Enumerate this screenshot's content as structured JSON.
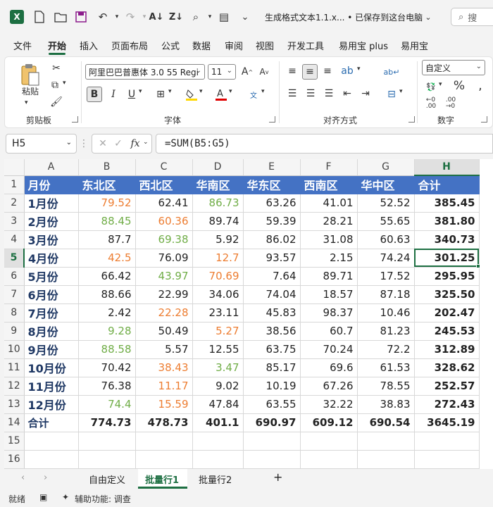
{
  "titlebar": {
    "document_title": "生成格式文本1.1.x... • 已保存到这台电脑",
    "search_placeholder": "搜"
  },
  "menu": [
    "文件",
    "开始",
    "插入",
    "页面布局",
    "公式",
    "数据",
    "审阅",
    "视图",
    "开发工具",
    "易用宝 plus",
    "易用宝"
  ],
  "ribbon": {
    "paste_label": "粘贴",
    "font_name": "阿里巴巴普惠体 3.0 55 Regi",
    "font_size": "11",
    "bold": "B",
    "italic": "I",
    "number_format": "自定义",
    "groups": {
      "clipboard": "剪贴板",
      "font": "字体",
      "alignment": "对齐方式",
      "number": "数字"
    }
  },
  "formula_bar": {
    "name_box": "H5",
    "formula": "=SUM(B5:G5)"
  },
  "grid": {
    "columns": [
      "A",
      "B",
      "C",
      "D",
      "E",
      "F",
      "G",
      "H"
    ],
    "row_numbers": [
      "1",
      "2",
      "3",
      "4",
      "5",
      "6",
      "7",
      "8",
      "9",
      "10",
      "11",
      "12",
      "13",
      "14",
      "15",
      "16"
    ],
    "header": [
      "月份",
      "东北区",
      "西北区",
      "华南区",
      "华东区",
      "西南区",
      "华中区",
      "合计"
    ],
    "rows": [
      {
        "label": "1月份",
        "values": [
          "79.52",
          "62.41",
          "86.73",
          "63.26",
          "41.01",
          "52.52"
        ],
        "total": "385.45",
        "colors": [
          "orange",
          "",
          "green",
          "",
          "",
          ""
        ]
      },
      {
        "label": "2月份",
        "values": [
          "88.45",
          "60.36",
          "89.74",
          "59.39",
          "28.21",
          "55.65"
        ],
        "total": "381.80",
        "colors": [
          "green",
          "orange",
          "",
          "",
          "",
          ""
        ]
      },
      {
        "label": "3月份",
        "values": [
          "87.7",
          "69.38",
          "5.92",
          "86.02",
          "31.08",
          "60.63"
        ],
        "total": "340.73",
        "colors": [
          "",
          "green",
          "",
          "",
          "",
          ""
        ]
      },
      {
        "label": "4月份",
        "values": [
          "42.5",
          "76.09",
          "12.7",
          "93.57",
          "2.15",
          "74.24"
        ],
        "total": "301.25",
        "colors": [
          "orange",
          "",
          "orange",
          "",
          "",
          ""
        ]
      },
      {
        "label": "5月份",
        "values": [
          "66.42",
          "43.97",
          "70.69",
          "7.64",
          "89.71",
          "17.52"
        ],
        "total": "295.95",
        "colors": [
          "",
          "green",
          "orange",
          "",
          "",
          ""
        ]
      },
      {
        "label": "6月份",
        "values": [
          "88.66",
          "22.99",
          "34.06",
          "74.04",
          "18.57",
          "87.18"
        ],
        "total": "325.50",
        "colors": [
          "",
          "",
          "",
          "",
          "",
          ""
        ]
      },
      {
        "label": "7月份",
        "values": [
          "2.42",
          "22.28",
          "23.11",
          "45.83",
          "98.37",
          "10.46"
        ],
        "total": "202.47",
        "colors": [
          "",
          "orange",
          "",
          "",
          "",
          ""
        ]
      },
      {
        "label": "8月份",
        "values": [
          "9.28",
          "50.49",
          "5.27",
          "38.56",
          "60.7",
          "81.23"
        ],
        "total": "245.53",
        "colors": [
          "green",
          "",
          "orange",
          "",
          "",
          ""
        ]
      },
      {
        "label": "9月份",
        "values": [
          "88.58",
          "5.57",
          "12.55",
          "63.75",
          "70.24",
          "72.2"
        ],
        "total": "312.89",
        "colors": [
          "green",
          "",
          "",
          "",
          "",
          ""
        ]
      },
      {
        "label": "10月份",
        "values": [
          "70.42",
          "38.43",
          "3.47",
          "85.17",
          "69.6",
          "61.53"
        ],
        "total": "328.62",
        "colors": [
          "",
          "orange",
          "green",
          "",
          "",
          ""
        ]
      },
      {
        "label": "11月份",
        "values": [
          "76.38",
          "11.17",
          "9.02",
          "10.19",
          "67.26",
          "78.55"
        ],
        "total": "252.57",
        "colors": [
          "",
          "orange",
          "",
          "",
          "",
          ""
        ]
      },
      {
        "label": "12月份",
        "values": [
          "74.4",
          "15.59",
          "47.84",
          "63.55",
          "32.22",
          "38.83"
        ],
        "total": "272.43",
        "colors": [
          "green",
          "orange",
          "",
          "",
          "",
          ""
        ]
      }
    ],
    "totals_row": {
      "label": "合计",
      "values": [
        "774.73",
        "478.73",
        "401.1",
        "690.97",
        "609.12",
        "690.54",
        "3645.19"
      ]
    },
    "active_cell": "H5"
  },
  "sheets": {
    "tabs": [
      "自由定义",
      "批量行1",
      "批量行2"
    ],
    "active": "批量行1",
    "add": "+"
  },
  "status": {
    "ready": "就绪",
    "accessibility": "辅助功能: 调查"
  },
  "colors": {
    "accent": "#1d6f42",
    "header_fill": "#4472c4",
    "green_text": "#70ad47",
    "orange_text": "#ed7d31",
    "label_text": "#1f3864"
  }
}
